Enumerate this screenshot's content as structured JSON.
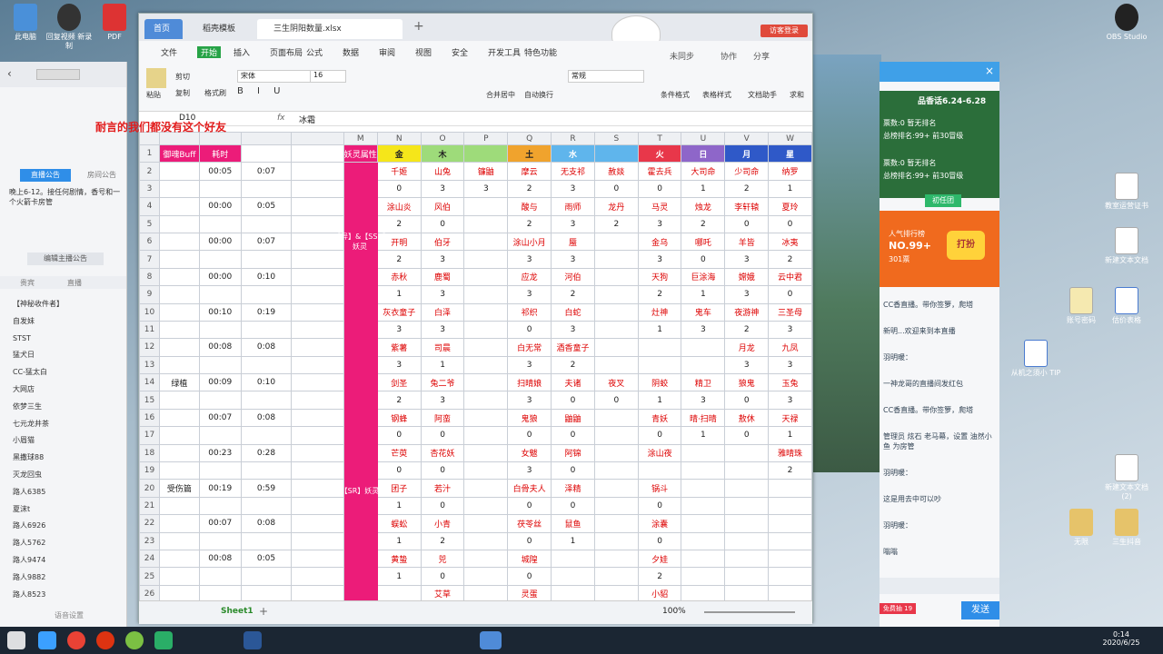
{
  "desktop": {
    "icons": [
      {
        "label": "此电脑"
      },
      {
        "label": "回复视频\n新录制"
      },
      {
        "label": "PDF"
      },
      {
        "label": "OBS Studio"
      },
      {
        "label": "教室运营证书"
      },
      {
        "label": "新建文本文档"
      },
      {
        "label": "账号密码"
      },
      {
        "label": "估价表格"
      },
      {
        "label": "从机之须小\nTIP"
      },
      {
        "label": "新建文本文档\n(2)"
      },
      {
        "label": "无限"
      },
      {
        "label": "三生抖音"
      }
    ]
  },
  "window": {
    "home_tab": "首页",
    "tab1": "稻壳模板",
    "tab2": "三生阴阳数量.xlsx",
    "login": "访客登录"
  },
  "menus": [
    "文件",
    "开始",
    "插入",
    "页面布局",
    "公式",
    "数据",
    "审阅",
    "视图",
    "安全",
    "开发工具",
    "特色功能"
  ],
  "menu_right": [
    "未同步",
    "协作",
    "分享"
  ],
  "ribbon": {
    "paste": "粘贴",
    "cut": "剪切",
    "copy": "复制",
    "format": "格式刷",
    "font": "宋体",
    "size": "16",
    "merge": "合并居中",
    "wrap": "自动换行",
    "numfmt": "常规",
    "cond": "条件格式",
    "table": "表格样式",
    "doc": "文档助手",
    "sum": "求和"
  },
  "formula": {
    "cell": "D10",
    "fx": "fx",
    "value": "冰霜"
  },
  "overlay_text": "耐言的我们都没有这个好友",
  "col_headers": [
    "J",
    "K",
    "L",
    "M",
    "N",
    "O",
    "P",
    "Q",
    "R",
    "S",
    "T",
    "U",
    "V",
    "W"
  ],
  "elements": [
    "金",
    "木",
    "土",
    "水",
    "火",
    "日",
    "月",
    "星"
  ],
  "rows": [
    [
      "1",
      "御魂Buff",
      "耗时",
      "",
      "",
      "妖灵属性",
      "金",
      "木",
      "",
      "土",
      "水",
      "",
      "火",
      "日",
      "月",
      "星"
    ],
    [
      "2",
      "",
      "00:05",
      "0:07",
      "",
      "",
      "千姬",
      "山兔",
      "镰鼬",
      "摩云",
      "无支祁",
      "赦燚",
      "霍去兵",
      "大司命",
      "少司命",
      "纳罗"
    ],
    [
      "3",
      "",
      "",
      "",
      "",
      "",
      "0",
      "3",
      "3",
      "2",
      "3",
      "0",
      "0",
      "1",
      "2",
      "1"
    ],
    [
      "4",
      "",
      "00:00",
      "0:05",
      "",
      "",
      "涂山炎",
      "风伯",
      "",
      "酸与",
      "雨师",
      "龙丹",
      "马灵",
      "烛龙",
      "李轩辕",
      "夏玲"
    ],
    [
      "5",
      "",
      "",
      "",
      "",
      "",
      "2",
      "0",
      "",
      "2",
      "3",
      "2",
      "3",
      "2",
      "0",
      "0"
    ],
    [
      "6",
      "",
      "00:00",
      "0:07",
      "",
      "",
      "开明",
      "伯牙",
      "",
      "涂山小月",
      "蜃",
      "",
      "金乌",
      "哪吒",
      "羊皆",
      "冰夷"
    ],
    [
      "7",
      "",
      "",
      "",
      "",
      "",
      "2",
      "3",
      "",
      "3",
      "3",
      "",
      "3",
      "0",
      "3",
      "2"
    ],
    [
      "8",
      "",
      "00:00",
      "0:10",
      "",
      "",
      "赤秋",
      "鹿蜀",
      "",
      "应龙",
      "河伯",
      "",
      "天狗",
      "巨涂海",
      "嫦娥",
      "云中君"
    ],
    [
      "9",
      "",
      "",
      "",
      "",
      "",
      "1",
      "3",
      "",
      "3",
      "2",
      "",
      "2",
      "1",
      "3",
      "0"
    ],
    [
      "10",
      "",
      "00:10",
      "0:19",
      "",
      "",
      "灰衣童子",
      "白泽",
      "",
      "祁织",
      "白蛇",
      "",
      "灶神",
      "鬼车",
      "夜游神",
      "三圣母"
    ],
    [
      "11",
      "",
      "",
      "",
      "",
      "",
      "3",
      "3",
      "",
      "0",
      "3",
      "",
      "1",
      "3",
      "2",
      "3"
    ],
    [
      "12",
      "",
      "00:08",
      "0:08",
      "",
      "",
      "紫薯",
      "司晨",
      "",
      "白无常",
      "酒香童子",
      "",
      "",
      "",
      "月龙",
      "九凤"
    ],
    [
      "13",
      "",
      "",
      "",
      "",
      "",
      "3",
      "1",
      "",
      "3",
      "2",
      "",
      "",
      "",
      "3",
      "3"
    ],
    [
      "14",
      "绿植",
      "00:09",
      "0:10",
      "",
      "",
      "剑圣",
      "兔二爷",
      "",
      "扫晴娘",
      "夫诸",
      "夜叉",
      "阴蛟",
      "精卫",
      "狼鬼",
      "玉兔"
    ],
    [
      "15",
      "",
      "",
      "",
      "",
      "",
      "2",
      "3",
      "",
      "3",
      "0",
      "0",
      "1",
      "3",
      "0",
      "3"
    ],
    [
      "16",
      "",
      "00:07",
      "0:08",
      "",
      "",
      "钢蜂",
      "阿蛮",
      "",
      "鬼狼",
      "鼬鼬",
      "",
      "青妖",
      "晴·扫晴",
      "敖休",
      "天禄"
    ],
    [
      "17",
      "",
      "",
      "",
      "",
      "",
      "0",
      "0",
      "",
      "0",
      "0",
      "",
      "0",
      "1",
      "0",
      "1"
    ],
    [
      "18",
      "",
      "00:23",
      "0:28",
      "",
      "",
      "芒萸",
      "杏花妖",
      "",
      "女魃",
      "阿锦",
      "",
      "涂山夜",
      "",
      "",
      "雅晴珠"
    ],
    [
      "19",
      "",
      "",
      "",
      "",
      "",
      "0",
      "0",
      "",
      "3",
      "0",
      "",
      "",
      "",
      "",
      "2"
    ],
    [
      "20",
      "受伤篇",
      "00:19",
      "0:59",
      "",
      "",
      "团子",
      "若汁",
      "",
      "白骨夫人",
      "泽精",
      "",
      "锅斗",
      "",
      "",
      ""
    ],
    [
      "21",
      "",
      "",
      "",
      "",
      "",
      "1",
      "0",
      "",
      "0",
      "0",
      "",
      "0",
      "",
      "",
      ""
    ],
    [
      "22",
      "",
      "00:07",
      "0:08",
      "",
      "",
      "蜈蚣",
      "小青",
      "",
      "茯苓丝",
      "鼠鱼",
      "",
      "涂囊",
      "",
      "",
      ""
    ],
    [
      "23",
      "",
      "",
      "",
      "",
      "",
      "1",
      "2",
      "",
      "0",
      "1",
      "",
      "0",
      "",
      "",
      ""
    ],
    [
      "24",
      "",
      "00:08",
      "0:05",
      "",
      "",
      "黄蛰",
      "兕",
      "",
      "城隍",
      "",
      "",
      "夕娃",
      "",
      "",
      ""
    ],
    [
      "25",
      "",
      "",
      "",
      "",
      "",
      "1",
      "0",
      "",
      "0",
      "",
      "",
      "2",
      "",
      "",
      ""
    ],
    [
      "26",
      "",
      "",
      "",
      "",
      "",
      "",
      "艾草",
      "",
      "灵蛋",
      "",
      "",
      "小貂",
      "",
      "",
      ""
    ]
  ],
  "side_label_top": "【异】&【SSR】妖灵",
  "side_label_bottom": "【SR】妖灵",
  "sheet": "Sheet1",
  "zoom": "100%",
  "chat": {
    "top_tabs": [
      "直播公告",
      "房间公告"
    ],
    "notice": "晚上6-12。接任何剧情，香号和一个火箭卡房管",
    "buttons": [
      "编辑主播公告"
    ],
    "list_tabs": [
      "贵宾",
      "直播",
      "粉丝"
    ],
    "users": [
      "【神秘收件者】",
      "自发妹",
      "STST",
      "猛犬日",
      "CC-猛太白",
      "大网店",
      "依梦三生",
      "七元龙井茶",
      "小眉猫",
      "黑撒球88",
      "灭龙回虫",
      "路人6385",
      "夏沫t",
      "路人6926",
      "路人5762",
      "路人9474",
      "路人9882",
      "路人8523"
    ],
    "bottom": "语音设置"
  },
  "right": {
    "date_range": "品香话6.24-6.28",
    "rank1": "票数:0 暂无排名",
    "rank1b": "总榜排名:99+ 前30冒级",
    "rank2": "票数:0 暂无排名",
    "rank2b": "总榜排名:99+ 前30冒级",
    "tab": "初任团",
    "hot": "人气排行榜",
    "hot_rank": "NO.99+",
    "hot_sub": "301票",
    "hit_btn": "打扮",
    "msgs": [
      "CC香直播。带你签箩，爬塔",
      "新明...欢迎来到本直播",
      "羽明暖：",
      "一神龙哥的直播间发红包",
      "CC香直播。带你签箩，爬塔",
      "管理员 炫石 老马幕，设置 油然小鱼 为房管",
      "羽明暖：",
      "这是用去中可以吵",
      "羽明暖：",
      "嗡嗡"
    ],
    "send": "发送",
    "badge": "免费抽 19"
  },
  "tray": {
    "time": "0:14",
    "date": "2020/6/25"
  },
  "colors": {
    "pink": "#ec1c79",
    "gold": "#f5e61a",
    "green": "#9edb7a",
    "orange": "#f0a32d",
    "blue": "#5fb5ec",
    "red": "#e8374a",
    "purple": "#8e66c9",
    "indigo": "#2f59c8",
    "wps_green": "#27a347"
  }
}
